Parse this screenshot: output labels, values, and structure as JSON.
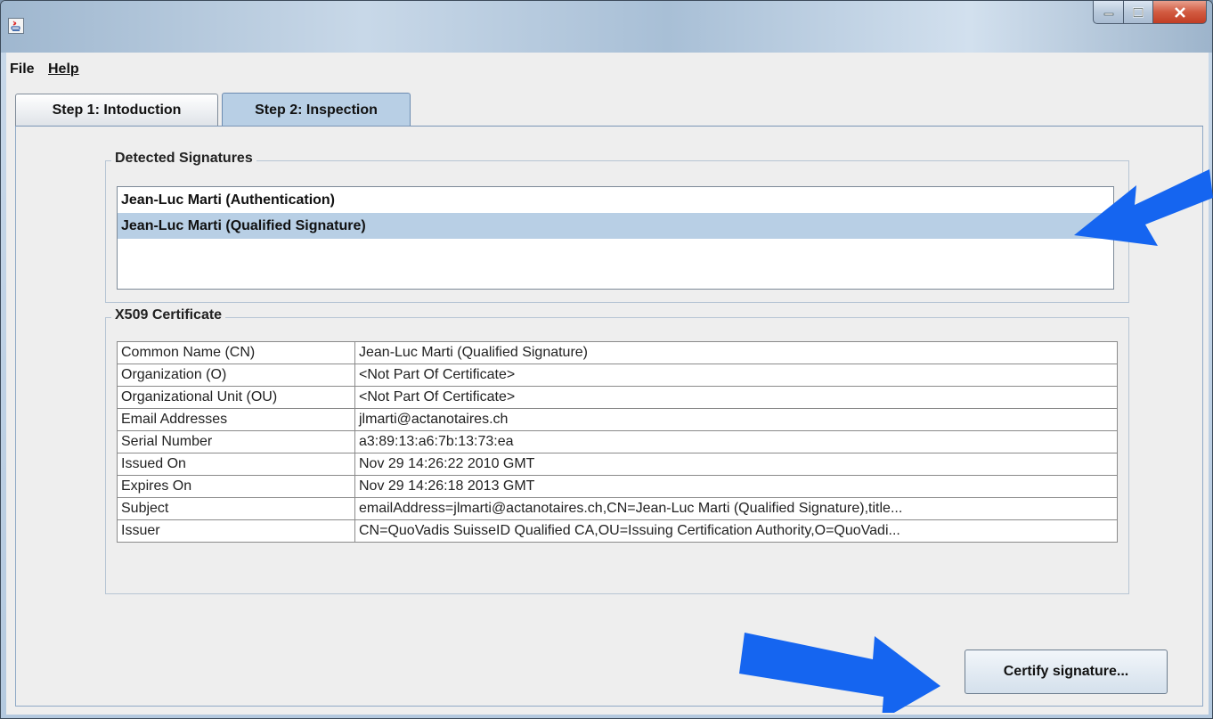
{
  "window": {
    "controls": [
      "minimize-icon",
      "maximize-icon",
      "close-icon"
    ]
  },
  "menu": {
    "items": [
      {
        "label": "File"
      },
      {
        "label": "Help"
      }
    ]
  },
  "tabs": [
    {
      "label": "Step 1: Intoduction"
    },
    {
      "label": "Step 2: Inspection"
    }
  ],
  "signatures": {
    "title": "Detected Signatures",
    "items": [
      {
        "label": "Jean-Luc Marti (Authentication)"
      },
      {
        "label": "Jean-Luc Marti (Qualified Signature)"
      }
    ],
    "selected_index": 1
  },
  "certificate": {
    "title": "X509 Certificate",
    "rows": [
      {
        "key": "Common Name (CN)",
        "value": "Jean-Luc Marti (Qualified Signature)"
      },
      {
        "key": "Organization (O)",
        "value": "<Not Part Of Certificate>"
      },
      {
        "key": "Organizational Unit (OU)",
        "value": "<Not Part Of Certificate>"
      },
      {
        "key": "Email Addresses",
        "value": "jlmarti@actanotaires.ch"
      },
      {
        "key": "Serial Number",
        "value": "a3:89:13:a6:7b:13:73:ea"
      },
      {
        "key": "Issued On",
        "value": "Nov 29 14:26:22 2010 GMT"
      },
      {
        "key": "Expires On",
        "value": "Nov 29 14:26:18 2013 GMT"
      },
      {
        "key": "Subject",
        "value": "emailAddress=jlmarti@actanotaires.ch,CN=Jean-Luc Marti (Qualified Signature),title..."
      },
      {
        "key": "Issuer",
        "value": "CN=QuoVadis SuisseID Qualified CA,OU=Issuing Certification Authority,O=QuoVadi..."
      }
    ]
  },
  "actions": {
    "certify_label": "Certify signature..."
  },
  "colors": {
    "selection": "#b8cfe5",
    "annotation_arrow": "#1565f0"
  }
}
